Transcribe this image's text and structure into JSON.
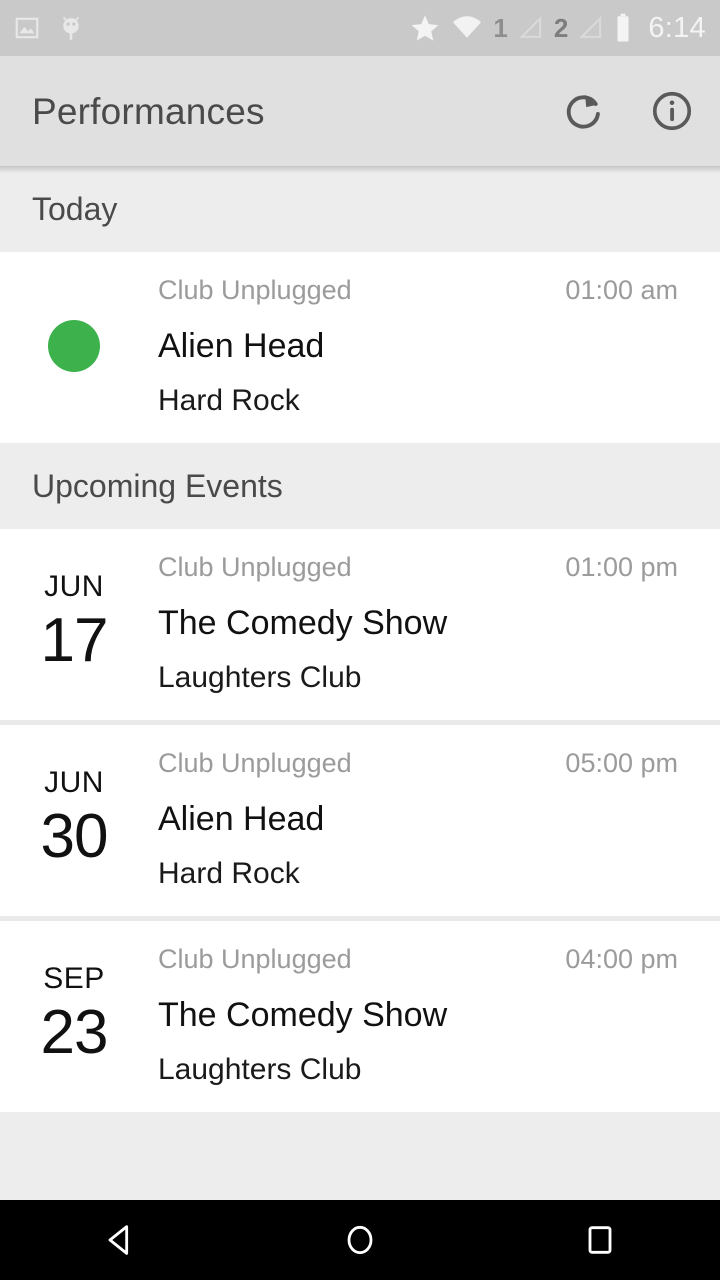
{
  "status_bar": {
    "icons_left": [
      "image-icon",
      "android-bug-icon"
    ],
    "icons_right": [
      "star-icon",
      "wifi-icon",
      "signal-1-icon",
      "signal-2-icon",
      "battery-icon"
    ],
    "sim1_label": "1",
    "sim2_label": "2",
    "time": "6:14",
    "background_color": "#c9c9c9"
  },
  "app_bar": {
    "title": "Performances",
    "refresh_label": "refresh",
    "info_label": "info",
    "background_color": "#e0e0e0"
  },
  "sections": [
    {
      "header": "Today",
      "events": [
        {
          "lead_type": "dot",
          "dot_color": "#3db14b",
          "month": "",
          "day": "",
          "venue": "Club Unplugged",
          "time": "01:00 am",
          "title": "Alien Head",
          "subtitle": "Hard Rock"
        }
      ]
    },
    {
      "header": "Upcoming Events",
      "events": [
        {
          "lead_type": "date",
          "dot_color": "",
          "month": "JUN",
          "day": "17",
          "venue": "Club Unplugged",
          "time": "01:00 pm",
          "title": "The Comedy Show",
          "subtitle": "Laughters Club"
        },
        {
          "lead_type": "date",
          "dot_color": "",
          "month": "JUN",
          "day": "30",
          "venue": "Club Unplugged",
          "time": "05:00 pm",
          "title": "Alien Head",
          "subtitle": "Hard Rock"
        },
        {
          "lead_type": "date",
          "dot_color": "",
          "month": "SEP",
          "day": "23",
          "venue": "Club Unplugged",
          "time": "04:00 pm",
          "title": "The Comedy Show",
          "subtitle": "Laughters Club"
        }
      ]
    }
  ],
  "nav_bar": {
    "back_label": "back",
    "home_label": "home",
    "recents_label": "recents",
    "background_color": "#000000"
  }
}
